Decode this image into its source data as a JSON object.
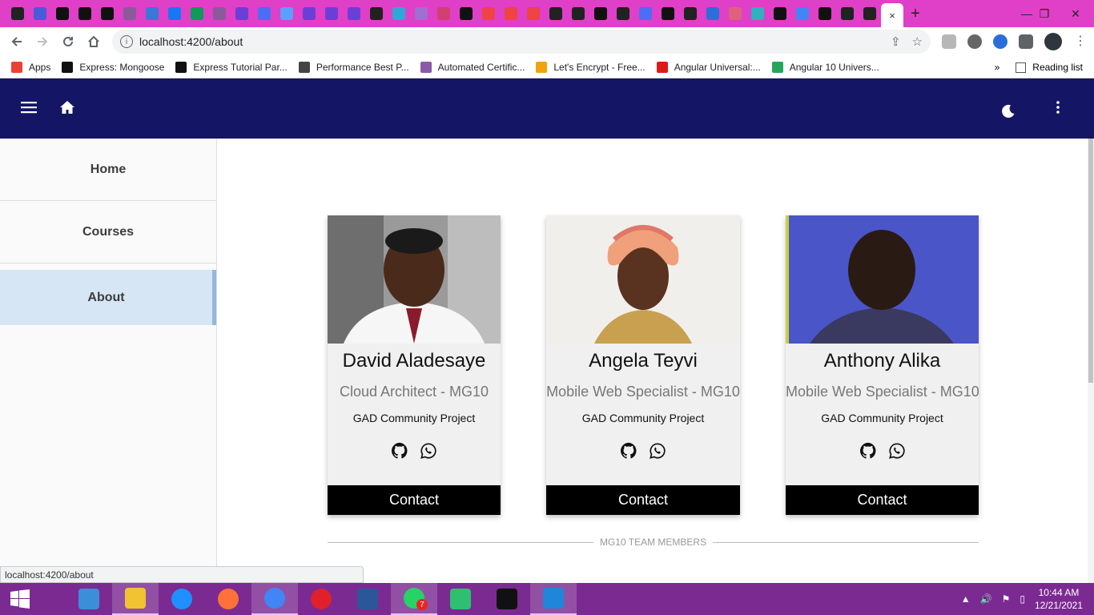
{
  "browser": {
    "tab_favicon_colors": [
      "#222",
      "#4a5ad9",
      "#111",
      "#111",
      "#111",
      "#8a5a9a",
      "#3a78d8",
      "#1877f2",
      "#0e9a58",
      "#8a5a9a",
      "#6b3fd6",
      "#4c6ef5",
      "#5aa0ff",
      "#6b3fd6",
      "#6b3fd6",
      "#6b3fd6",
      "#222",
      "#2ea8d8",
      "#a070d0",
      "#d04070",
      "#111",
      "#e44",
      "#e44",
      "#e44",
      "#222",
      "#222",
      "#111",
      "#222",
      "#4c6ef5",
      "#111",
      "#222",
      "#2a70d8",
      "#e06080",
      "#30b0c0",
      "#111",
      "#4285f4",
      "#111",
      "#222",
      "#222"
    ],
    "active_tab_close": "×",
    "new_tab": "+",
    "window_controls": {
      "minimize": "—",
      "restore": "❐",
      "close": "✕"
    },
    "address": "localhost:4200/about",
    "bookmarks": [
      {
        "label": "Apps",
        "icon": "apps-grid-icon",
        "color": "#e94235"
      },
      {
        "label": "Express: Mongoose",
        "icon": "express-icon",
        "color": "#111"
      },
      {
        "label": "Express Tutorial Par...",
        "icon": "express-icon",
        "color": "#111"
      },
      {
        "label": "Performance Best P...",
        "icon": "ex-icon",
        "color": "#444"
      },
      {
        "label": "Automated Certific...",
        "icon": "certific-icon",
        "color": "#8a5aa8"
      },
      {
        "label": "Let's Encrypt - Free...",
        "icon": "letsencrypt-icon",
        "color": "#f1a40f"
      },
      {
        "label": "Angular Universal:...",
        "icon": "angular-icon",
        "color": "#dd1b16"
      },
      {
        "label": "Angular 10 Univers...",
        "icon": "medium-icon",
        "color": "#26a65b"
      }
    ],
    "bookmarks_overflow": "»",
    "reading_list": "Reading list",
    "status_url": "localhost:4200/about"
  },
  "nav": {
    "items": [
      {
        "label": "Home"
      },
      {
        "label": "Courses"
      },
      {
        "label": "About"
      }
    ],
    "active": "About"
  },
  "team": {
    "members": [
      {
        "name": "David Aladesaye",
        "role": "Cloud Architect - MG10",
        "org": "GAD Community Project",
        "contact": "Contact"
      },
      {
        "name": "Angela Teyvi",
        "role": "Mobile Web Specialist - MG10",
        "org": "GAD Community Project",
        "contact": "Contact"
      },
      {
        "name": "Anthony Alika",
        "role": "Mobile Web Specialist - MG10",
        "org": "GAD Community Project",
        "contact": "Contact"
      }
    ],
    "divider_label": "MG10 TEAM MEMBERS"
  },
  "taskbar": {
    "apps": [
      {
        "name": "calculator",
        "color": "#3b8fd9"
      },
      {
        "name": "file-explorer",
        "color": "#f1c232"
      },
      {
        "name": "internet-explorer",
        "color": "#1e90ff"
      },
      {
        "name": "firefox",
        "color": "#ff7139"
      },
      {
        "name": "chrome",
        "color": "#4285f4"
      },
      {
        "name": "opera",
        "color": "#e0202a"
      },
      {
        "name": "word",
        "color": "#2b579a"
      },
      {
        "name": "whatsapp",
        "color": "#25d366"
      },
      {
        "name": "app-green",
        "color": "#2fbf71"
      },
      {
        "name": "command-prompt",
        "color": "#111"
      },
      {
        "name": "vscode",
        "color": "#1f86d9"
      }
    ],
    "whatsapp_badge": "7",
    "time": "10:44 AM",
    "date": "12/21/2021"
  }
}
